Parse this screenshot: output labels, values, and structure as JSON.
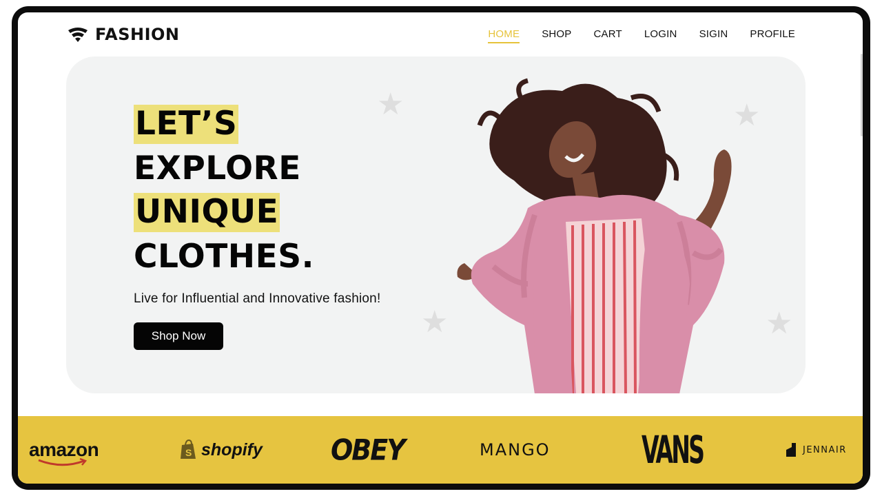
{
  "brand": {
    "name": "FASHION",
    "icon": "wifi-fan-icon"
  },
  "nav": [
    {
      "label": "HOME",
      "active": true
    },
    {
      "label": "SHOP",
      "active": false
    },
    {
      "label": "CART",
      "active": false
    },
    {
      "label": "LOGIN",
      "active": false
    },
    {
      "label": "SIGIN",
      "active": false
    },
    {
      "label": "PROFILE",
      "active": false
    }
  ],
  "hero": {
    "lines": [
      "LET’S",
      "EXPLORE",
      "UNIQUE",
      "CLOTHES."
    ],
    "tagline": "Live for Influential and Innovative fashion!",
    "cta": "Shop Now"
  },
  "brands": [
    {
      "name": "amazon",
      "icon": "amazon-smile-icon"
    },
    {
      "name": "shopify",
      "icon": "shopify-bag-icon"
    },
    {
      "name": "OBEY"
    },
    {
      "name": "MANGO"
    },
    {
      "name": "VANS"
    },
    {
      "name": "JENNAIR",
      "icon": "jennair-logo-icon"
    }
  ],
  "colors": {
    "accent": "#e6c33a",
    "highlight": "#ede07a",
    "strip": "#e6c440",
    "hero_bg": "#f2f3f3",
    "button": "#050505"
  }
}
